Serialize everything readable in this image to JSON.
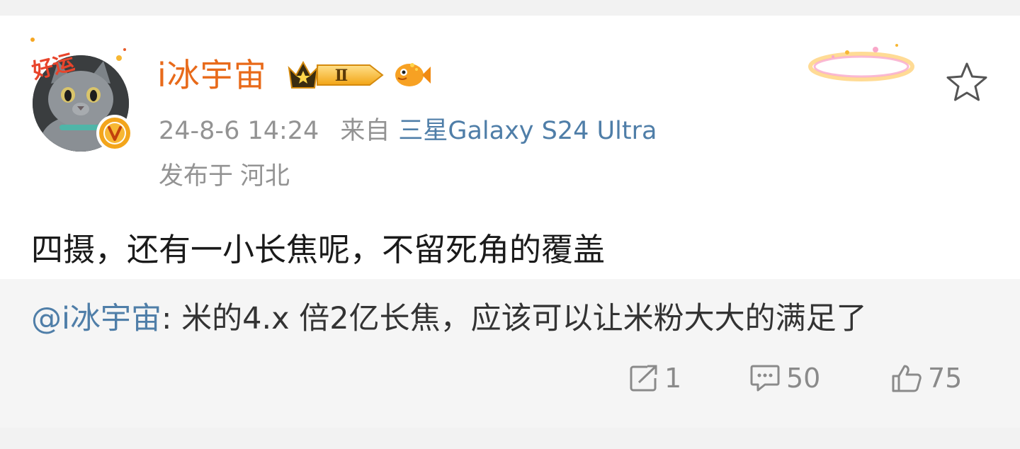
{
  "post": {
    "username": "i冰宇宙",
    "member_level": "Ⅱ",
    "avatar_deco_text": "好运",
    "time": "24-8-6 14:24",
    "from_label": "来自",
    "device": "三星Galaxy S24 Ultra",
    "location_label": "发布于",
    "location": "河北",
    "text": "四摄，还有一小长焦呢，不留死角的覆盖"
  },
  "quote": {
    "mention": "@i冰宇宙",
    "text": ": 米的4.x 倍2亿长焦，应该可以让米粉大大的满足了"
  },
  "actions": {
    "repost_count": "1",
    "comment_count": "50",
    "like_count": "75"
  },
  "icons": {
    "favorite": "star-outline-icon",
    "repost": "repost-icon",
    "comment": "comment-icon",
    "like": "thumbs-up-icon",
    "verified": "verified-v-icon"
  },
  "colors": {
    "username": "#e86a1a",
    "link": "#4f7ea8",
    "meta": "#939393",
    "quote_bg": "#f5f5f5"
  }
}
